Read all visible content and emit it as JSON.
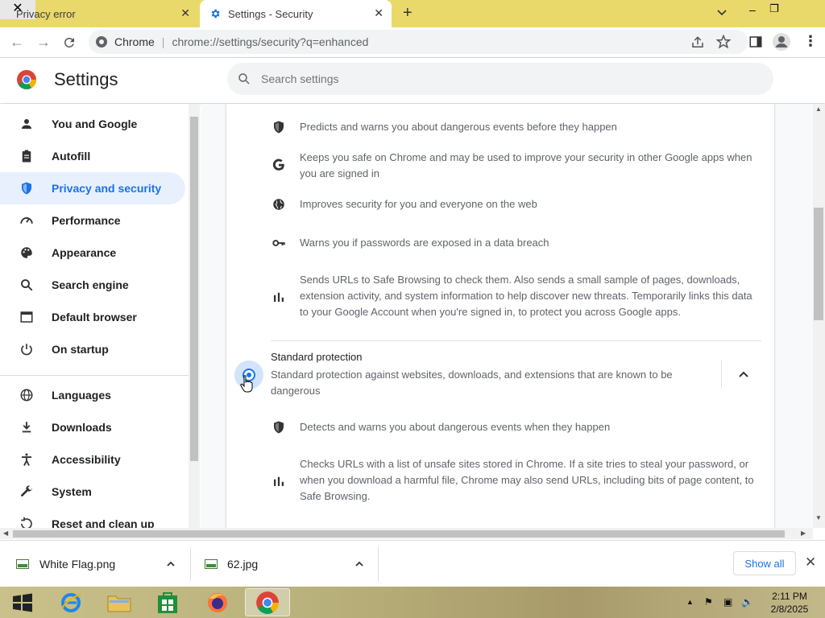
{
  "tabs": [
    {
      "title": "Privacy error",
      "active": false
    },
    {
      "title": "Settings - Security",
      "active": true
    }
  ],
  "window": {
    "new_tab": "+",
    "dropdown": "⌄",
    "minimize": "–",
    "maximize": "❐",
    "close": "✕"
  },
  "toolbar": {
    "site_label": "Chrome",
    "separator": "|",
    "url": "chrome://settings/security?q=enhanced"
  },
  "settings": {
    "title": "Settings",
    "search_placeholder": "Search settings"
  },
  "sidebar": {
    "items": [
      {
        "label": "You and Google",
        "icon": "person-icon"
      },
      {
        "label": "Autofill",
        "icon": "clipboard-icon"
      },
      {
        "label": "Privacy and security",
        "icon": "shield-icon",
        "selected": true
      },
      {
        "label": "Performance",
        "icon": "speedometer-icon"
      },
      {
        "label": "Appearance",
        "icon": "palette-icon"
      },
      {
        "label": "Search engine",
        "icon": "search-icon"
      },
      {
        "label": "Default browser",
        "icon": "browser-icon"
      },
      {
        "label": "On startup",
        "icon": "power-icon"
      },
      {
        "label": "Languages",
        "icon": "globe-icon"
      },
      {
        "label": "Downloads",
        "icon": "download-icon"
      },
      {
        "label": "Accessibility",
        "icon": "accessibility-icon"
      },
      {
        "label": "System",
        "icon": "wrench-icon"
      },
      {
        "label": "Reset and clean up",
        "icon": "reset-icon"
      }
    ]
  },
  "enhanced_features": [
    {
      "icon": "shield-icon",
      "text": "Predicts and warns you about dangerous events before they happen"
    },
    {
      "icon": "google-g-icon",
      "text": "Keeps you safe on Chrome and may be used to improve your security in other Google apps when you are signed in"
    },
    {
      "icon": "globe-icon",
      "text": "Improves security for you and everyone on the web"
    },
    {
      "icon": "key-icon",
      "text": "Warns you if passwords are exposed in a data breach"
    },
    {
      "icon": "bar-chart-icon",
      "text": "Sends URLs to Safe Browsing to check them. Also sends a small sample of pages, downloads, extension activity, and system information to help discover new threats. Temporarily links this data to your Google Account when you're signed in, to protect you across Google apps."
    }
  ],
  "standard_protection": {
    "title": "Standard protection",
    "description": "Standard protection against websites, downloads, and extensions that are known to be dangerous",
    "selected": true,
    "features": [
      {
        "icon": "shield-icon",
        "text": "Detects and warns you about dangerous events when they happen"
      },
      {
        "icon": "bar-chart-icon",
        "text": "Checks URLs with a list of unsafe sites stored in Chrome. If a site tries to steal your password, or when you download a harmful file, Chrome may also send URLs, including bits of page content, to Safe Browsing."
      }
    ]
  },
  "downloads": {
    "items": [
      {
        "name": "White Flag.png"
      },
      {
        "name": "62.jpg"
      }
    ],
    "show_all": "Show all"
  },
  "taskbar": {
    "apps": [
      "start-orb",
      "internet-explorer",
      "file-explorer",
      "store",
      "firefox",
      "chrome"
    ],
    "time": "2:11 PM",
    "date": "2/8/2025"
  },
  "colors": {
    "accent": "#1a73e8",
    "tabstrip": "#e9d96a",
    "selected_bg": "#e8f0fe"
  }
}
